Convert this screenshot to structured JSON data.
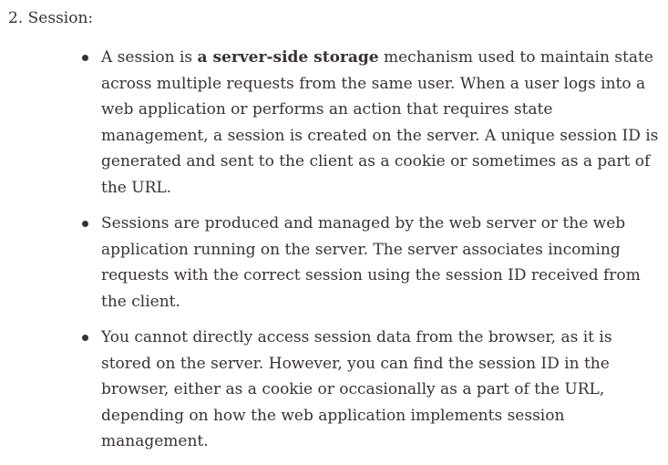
{
  "list_item": {
    "number": "2.",
    "title": "Session:"
  },
  "bullets": [
    {
      "before": "A session is ",
      "bold": "a server-side storage",
      "after": " mechanism used to maintain state across multiple requests from the same user. When a user logs into a web application or performs an action that requires state management, a session is created on the server. A unique session ID is generated and sent to the client as a cookie or sometimes as a part of the URL."
    },
    {
      "text": "Sessions are produced and managed by the web server or the web application running on the server. The server associates incoming requests with the correct session using the session ID received from the client."
    },
    {
      "text": "You cannot directly access session data from the browser, as it is stored on the server. However, you can find the session ID in the browser, either as a cookie or occasionally as a part of the URL, depending on how the web application implements session management."
    }
  ]
}
